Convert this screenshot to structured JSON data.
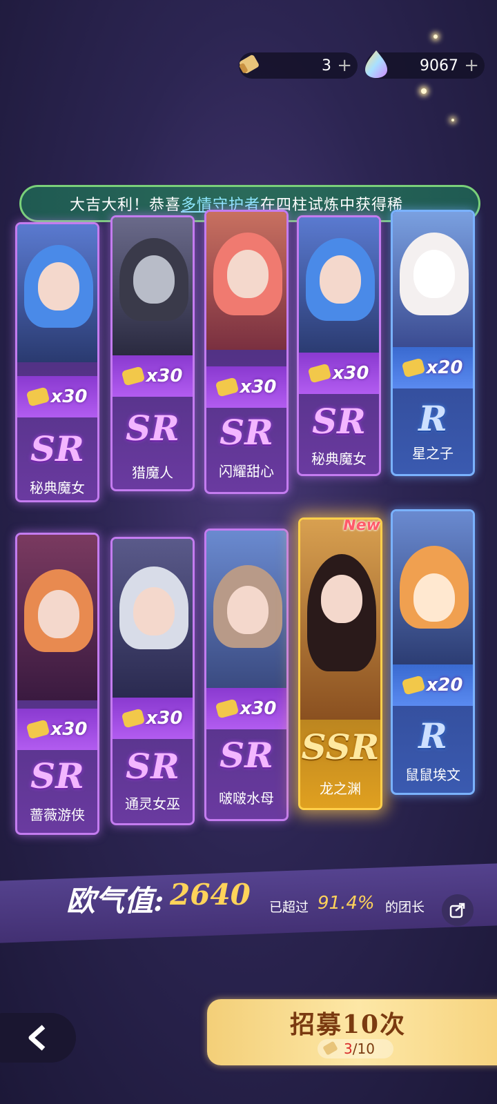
{
  "topbar": {
    "scroll_count": "3",
    "gem_count": "9067",
    "plus": "+"
  },
  "banner": {
    "prefix": "大吉大利！恭喜",
    "highlight": "多情守护者",
    "suffix": "在四柱试炼中获得稀"
  },
  "cards": [
    {
      "rarity": "SR",
      "name": "秘典魔女",
      "shards": "x30",
      "frame": "purple"
    },
    {
      "rarity": "SR",
      "name": "猎魔人",
      "shards": "x30",
      "frame": "purple"
    },
    {
      "rarity": "SR",
      "name": "闪耀甜心",
      "shards": "x30",
      "frame": "purple"
    },
    {
      "rarity": "SR",
      "name": "秘典魔女",
      "shards": "x30",
      "frame": "purple"
    },
    {
      "rarity": "R",
      "name": "星之子",
      "shards": "x20",
      "frame": "blue"
    },
    {
      "rarity": "SR",
      "name": "蔷薇游侠",
      "shards": "x30",
      "frame": "purple"
    },
    {
      "rarity": "SR",
      "name": "通灵女巫",
      "shards": "x30",
      "frame": "purple"
    },
    {
      "rarity": "SR",
      "name": "啵啵水母",
      "shards": "x30",
      "frame": "purple"
    },
    {
      "rarity": "SSR",
      "name": "龙之渊",
      "shards": "",
      "frame": "gold",
      "badge": "New"
    },
    {
      "rarity": "R",
      "name": "鼠鼠埃文",
      "shards": "x20",
      "frame": "blue"
    }
  ],
  "luck": {
    "label": "欧气值:",
    "value": "2640",
    "prefix": "已超过",
    "percent": "91.4%",
    "suffix": "的团长"
  },
  "recruit": {
    "label": "招募10次",
    "cost_current": "3",
    "cost_total": "/10"
  },
  "colors": {
    "sr_frame": "#c47cf0",
    "r_frame": "#7ab2ff",
    "ssr_frame": "#ffd04a",
    "luck_value": "#ffd35a"
  }
}
